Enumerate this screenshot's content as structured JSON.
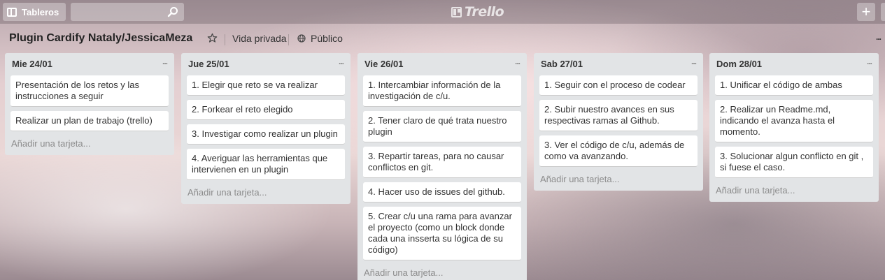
{
  "header": {
    "boards_label": "Tableros",
    "search_placeholder": "",
    "logo_text": "Trello",
    "add_label": "+"
  },
  "board": {
    "title": "Plugin Cardify Nataly/JessicaMeza",
    "privacy_label": "Vida privada",
    "visibility_label": "Público",
    "menu_label": "..."
  },
  "lists": [
    {
      "title": "Mie 24/01",
      "menu": "...",
      "cards": [
        "Presentación de los retos y las instrucciones a seguir",
        "Realizar un plan de trabajo (trello)"
      ],
      "add_label": "Añadir una tarjeta..."
    },
    {
      "title": "Jue 25/01",
      "menu": "...",
      "cards": [
        "1. Elegir que reto se va realizar",
        "2. Forkear el reto elegido",
        "3. Investigar como realizar un plugin",
        "4. Averiguar las herramientas que intervienen en un plugin"
      ],
      "add_label": "Añadir una tarjeta..."
    },
    {
      "title": "Vie 26/01",
      "menu": "...",
      "cards": [
        "1. Intercambiar información de la investigación de c/u.",
        "2. Tener claro de qué trata nuestro plugin",
        "3. Repartir tareas, para no causar conflictos en git.",
        "4. Hacer uso de issues del github.",
        "5. Crear c/u una rama para avanzar el proyecto (como un block donde cada una insserta su lógica de su código)"
      ],
      "add_label": "Añadir una tarjeta..."
    },
    {
      "title": "Sab 27/01",
      "menu": "...",
      "cards": [
        "1. Seguir con el proceso de codear",
        "2. Subir nuestro avances en sus respectivas ramas al Github.",
        "3. Ver el código de c/u, además de como va avanzando."
      ],
      "add_label": "Añadir una tarjeta..."
    },
    {
      "title": "Dom 28/01",
      "menu": "...",
      "cards": [
        "1. Unificar el código de ambas",
        "2. Realizar un Readme.md, indicando el avanza hasta el momento.",
        "3. Solucionar algun conflicto en git , si fuese el caso."
      ],
      "add_label": "Añadir una tarjeta..."
    }
  ]
}
